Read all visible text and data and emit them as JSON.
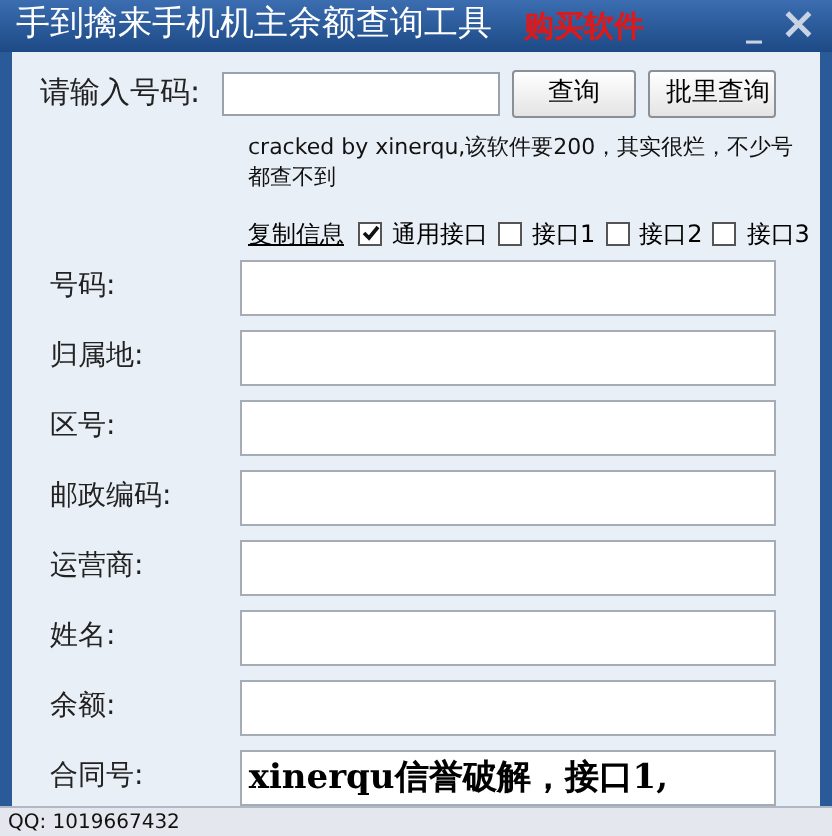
{
  "window": {
    "title": "手到擒来手机机主余额查询工具",
    "buy_link": "购买软件",
    "minimize": "_",
    "close": "×"
  },
  "query": {
    "label": "请输入号码:",
    "buttons": [
      "查询",
      "批里查询"
    ]
  },
  "note": "cracked by xinerqu,该软件要200，其实很烂，不少号都查不到",
  "copy_link": "复制信息",
  "interfaces": [
    {
      "label": "通用接口",
      "checked": true
    },
    {
      "label": "接口1",
      "checked": false
    },
    {
      "label": "接口2",
      "checked": false
    },
    {
      "label": "接口3",
      "checked": false
    }
  ],
  "fields": [
    {
      "label": "号码:"
    },
    {
      "label": "归属地:"
    },
    {
      "label": "区号:"
    },
    {
      "label": "邮政编码:"
    },
    {
      "label": "运营商:"
    },
    {
      "label": "姓名:"
    },
    {
      "label": "余额:"
    },
    {
      "label": "合同号:",
      "value": "xinerqu信誉破解，接口1,"
    }
  ],
  "status_bar": "QQ: 1019667432"
}
